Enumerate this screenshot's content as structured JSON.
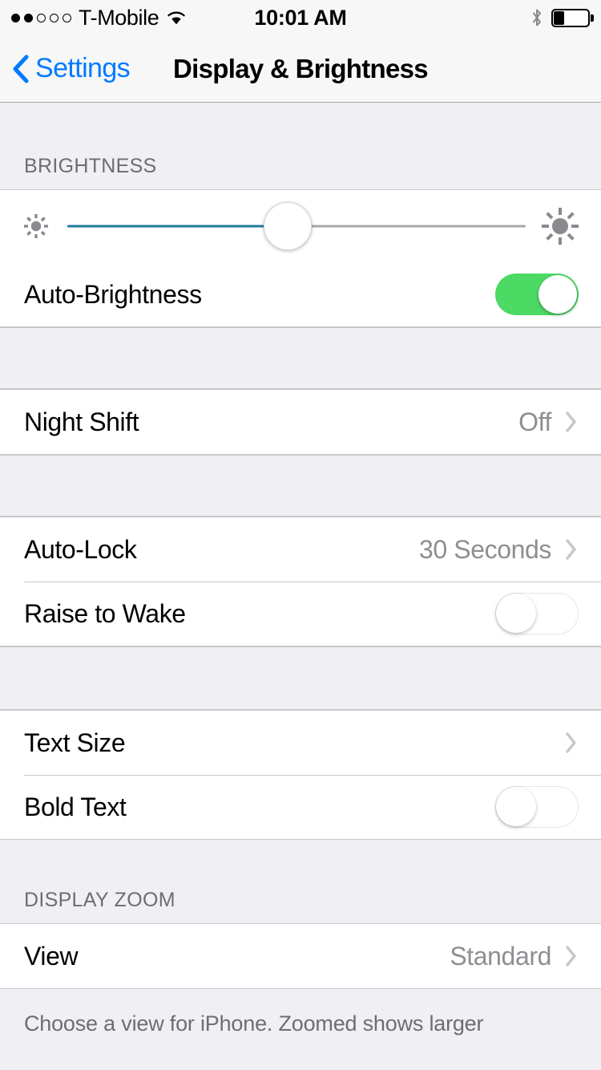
{
  "status_bar": {
    "signal_dots_filled": 2,
    "signal_dots_total": 5,
    "carrier": "T-Mobile",
    "wifi_icon": "wifi-icon",
    "time": "10:01 AM",
    "bluetooth_icon": "bluetooth-icon",
    "battery_icon": "battery-icon",
    "battery_percent": 30
  },
  "nav": {
    "back_label": "Settings",
    "back_icon": "chevron-left-icon",
    "title": "Display & Brightness"
  },
  "sections": {
    "brightness": {
      "header": "BRIGHTNESS",
      "slider": {
        "name": "brightness-slider",
        "value": 48,
        "min_icon": "sun-small-icon",
        "max_icon": "sun-large-icon",
        "fill_color": "#1d7a9c",
        "track_color": "#a9a9a9"
      },
      "auto_brightness": {
        "label": "Auto-Brightness",
        "toggle_state": "on",
        "toggle_color": "#4cd964"
      }
    },
    "night_shift": {
      "label": "Night Shift",
      "value": "Off",
      "accessory": "chevron-right-icon"
    },
    "lock": {
      "auto_lock": {
        "label": "Auto-Lock",
        "value": "30 Seconds",
        "accessory": "chevron-right-icon"
      },
      "raise_to_wake": {
        "label": "Raise to Wake",
        "toggle_state": "off"
      }
    },
    "text": {
      "text_size": {
        "label": "Text Size",
        "value": "",
        "accessory": "chevron-right-icon"
      },
      "bold_text": {
        "label": "Bold Text",
        "toggle_state": "off"
      }
    },
    "display_zoom": {
      "header": "DISPLAY ZOOM",
      "view": {
        "label": "View",
        "value": "Standard",
        "accessory": "chevron-right-icon"
      },
      "footer": "Choose a view for iPhone. Zoomed shows larger"
    }
  },
  "colors": {
    "tint": "#007aff",
    "background": "#efeff4",
    "separator": "#c8c7cc",
    "secondary_text": "#8e8e93"
  }
}
